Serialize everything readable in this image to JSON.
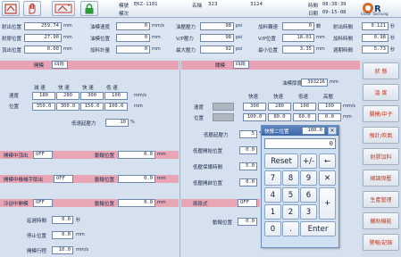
{
  "header": {
    "mold_label": "模號",
    "mold_value": "EKZ-1101",
    "name_label": "名稱",
    "name_value": "323",
    "count_value": "3124",
    "time_label": "時間",
    "time_value": "08:38:39",
    "date_label": "日期",
    "date_value": "09-15-08",
    "mode_value": "模次",
    "brand": "Victor Taichung"
  },
  "status": {
    "rows": [
      [
        "射出位置",
        "259.74",
        "mm",
        "油模速度",
        "0",
        "mm/s",
        "油壓壓力",
        "98",
        "psi",
        "加料轉速",
        "0",
        "轉",
        "射出時間",
        "0.121",
        "秒"
      ],
      [
        "射膠位置",
        "27.90",
        "mm",
        "油模位置",
        "0",
        "mm",
        "V/P壓力",
        "98",
        "psi",
        "V/P位置",
        "18.01",
        "mm",
        "加料時間",
        "0.98",
        "秒"
      ],
      [
        "頂出位置",
        "0.00",
        "mm",
        "加料計量",
        "0",
        "mm",
        "最大壓力",
        "92",
        "psi",
        "最小位置",
        "3.35",
        "mm",
        "週期時間",
        "5.73",
        "秒"
      ]
    ]
  },
  "left": {
    "tab_label": "開模",
    "tab_value": "四段",
    "col_headers": [
      "減 速",
      "快 速",
      "快 速",
      "低 速"
    ],
    "speed_label": "速度",
    "speed_values": [
      "180",
      "280",
      "300",
      "100"
    ],
    "speed_unit": "mm/s",
    "pos_label": "位置",
    "pos_values": [
      "350.0",
      "300.0",
      "150.0",
      "100.0"
    ],
    "pos_unit": "mm",
    "pressure_label": "低速起壓力",
    "pressure_value": "10",
    "pressure_unit": "%",
    "r1_label": "開模中頂出",
    "r1_value": "OFF",
    "r1b_label": "動輸位置",
    "r1b_value": "0.0",
    "r1b_unit": "mm",
    "r2_label": "開模中機械手取出",
    "r2_value": "OFF",
    "r2b_label": "動輸位置",
    "r2b_value": "0.0",
    "r2b_unit": "mm",
    "r3_label": "冷卻中開模",
    "r3_value": "OFF",
    "r3b_label": "動輸位置",
    "r3b_value": "0.0",
    "r3b_unit": "mm",
    "delay_label": "延遲時間",
    "delay_value": "0.0",
    "delay_unit": "秒",
    "stop_label": "停止位置",
    "stop_value": "0.0",
    "stop_unit": "mm",
    "final_label": "開模行程",
    "final_value": "10.0",
    "final_unit": "mm/s"
  },
  "right": {
    "tab_label": "關模",
    "tab_value": "四段",
    "thickness_label": "油模厚度",
    "thickness_value": "393216",
    "thickness_unit": "mm",
    "col_headers": [
      "快速",
      "快速",
      "低速",
      "高壓"
    ],
    "speed_label": "速度",
    "speed_values": [
      "",
      "300",
      "280",
      "100",
      "100"
    ],
    "speed_unit": "mm/s",
    "pos_label": "位置",
    "pos_values": [
      "",
      "100.0",
      "80.0",
      "60.0",
      "0.0"
    ],
    "pos_unit": "mm",
    "p1_label": "低壓起壓力",
    "p1_value": "5",
    "p1_unit": "%",
    "p2_label": "低壓開始位置",
    "p2_value": "0.0",
    "p2_unit": "mm",
    "p3_label": "低壓保護時間",
    "p3_value": "5.0",
    "p4_label": "低壓開啟位置",
    "p4_value": "0.0",
    "r3_label": "兩段式",
    "r3_value": "OFF",
    "r4_label": "動輸位置",
    "r4_value": "0.0"
  },
  "keypad": {
    "title": "快慢二位置",
    "current_value": "180.0",
    "entry_value": "0",
    "reset_label": "Reset",
    "plusminus_label": "+/-",
    "back_label": "←",
    "clear_label": "✕",
    "plus_label": "+",
    "enter_label": "Enter",
    "digits": [
      "7",
      "8",
      "9",
      "4",
      "5",
      "6",
      "1",
      "2",
      "3",
      "0",
      "."
    ]
  },
  "sidebar": {
    "items": [
      "狀 態",
      "溫 度",
      "關模/中子",
      "預計/吹氣",
      "射膠加料",
      "細調保壓",
      "生產管理",
      "輔助機能",
      "警報/記錄"
    ]
  },
  "colors": {
    "accent": "#c4391e",
    "section_red": "#e9a2b3",
    "panel": "#d5e1ee",
    "keypad": "#cfe0f2"
  }
}
